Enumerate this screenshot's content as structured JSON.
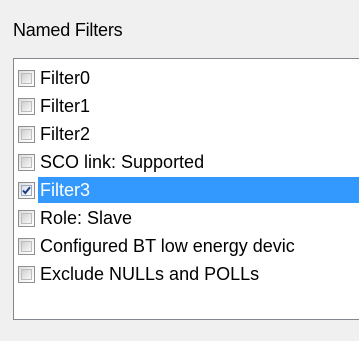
{
  "group": {
    "title": "Named Filters"
  },
  "filters": [
    {
      "label": "Filter0",
      "checked": false,
      "selected": false
    },
    {
      "label": "Filter1",
      "checked": false,
      "selected": false
    },
    {
      "label": "Filter2",
      "checked": false,
      "selected": false
    },
    {
      "label": "SCO link: Supported",
      "checked": false,
      "selected": false
    },
    {
      "label": "Filter3",
      "checked": true,
      "selected": true
    },
    {
      "label": "Role: Slave",
      "checked": false,
      "selected": false
    },
    {
      "label": "Configured BT low energy devic",
      "checked": false,
      "selected": false
    },
    {
      "label": "Exclude NULLs and POLLs",
      "checked": false,
      "selected": false
    }
  ],
  "colors": {
    "selection": "#3399ff",
    "selection_text": "#ffffff",
    "window_bg": "#f0f0f0",
    "list_bg": "#ffffff",
    "list_border": "#828790",
    "checkmark": "#1c3a8a"
  }
}
